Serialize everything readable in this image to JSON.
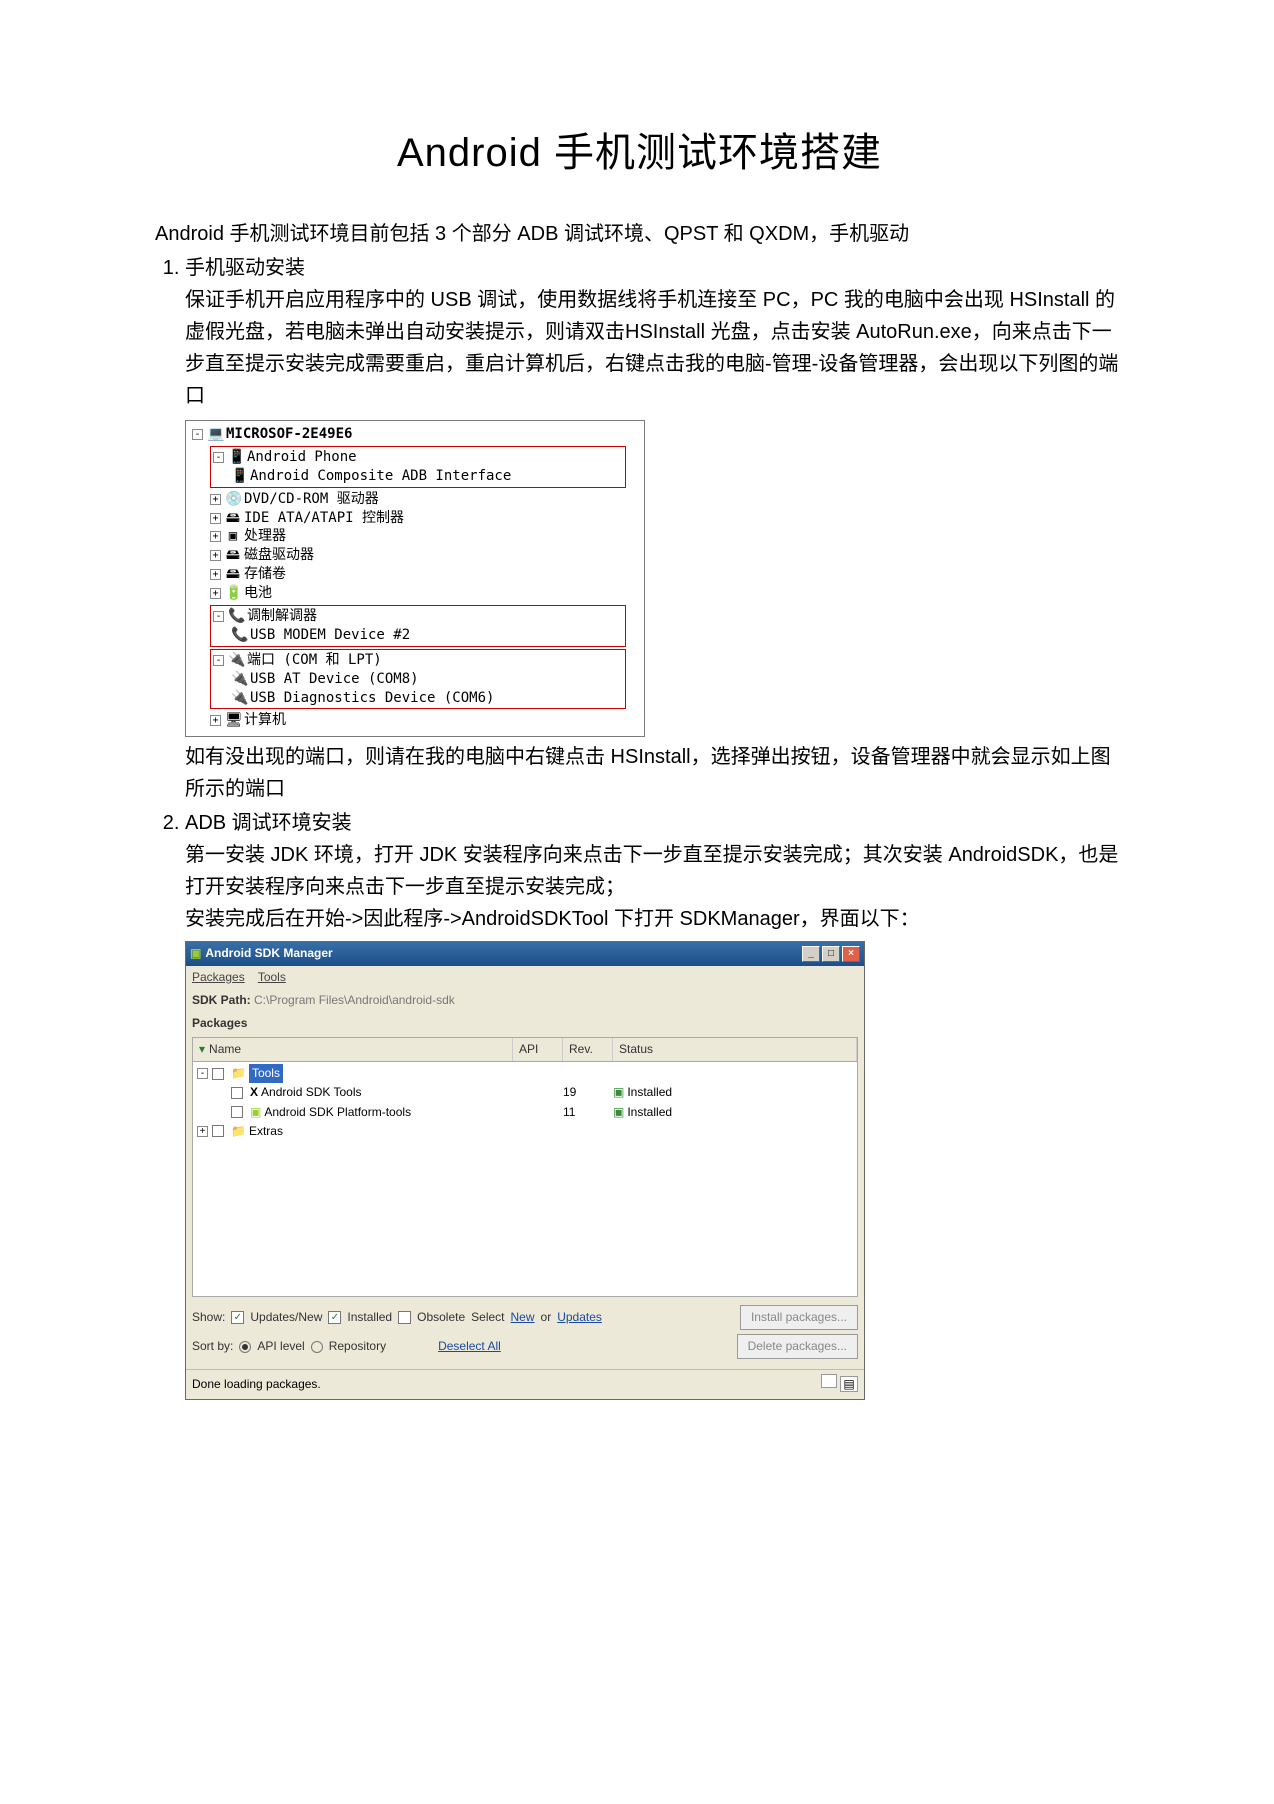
{
  "title": "Android 手机测试环境搭建",
  "intro": "Android 手机测试环境目前包括 3 个部分 ADB 调试环境、QPST 和 QXDM，手机驱动",
  "section1": {
    "heading": "手机驱动安装",
    "para1": "保证手机开启应用程序中的 USB 调试，使用数据线将手机连接至 PC，PC 我的电脑中会出现 HSInstall 的虚假光盘，若电脑未弹出自动安装提示，则请双击HSInstall 光盘，点击安装 AutoRun.exe，向来点击下一步直至提示安装完成需要重启，重启计算机后，右键点击我的电脑-管理-设备管理器，会出现以下列图的端口",
    "para2": "如有没出现的端口，则请在我的电脑中右键点击 HSInstall，选择弹出按钮，设备管理器中就会显示如上图所示的端口"
  },
  "devmgr": {
    "root": "MICROSOF-2E49E6",
    "android_phone": "Android Phone",
    "android_adb": "Android Composite ADB Interface",
    "dvd": "DVD/CD-ROM 驱动器",
    "ide": "IDE ATA/ATAPI 控制器",
    "cpu": "处理器",
    "disk": "磁盘驱动器",
    "vol": "存储卷",
    "battery": "电池",
    "modem": "调制解调器",
    "usb_modem": "USB MODEM Device #2",
    "ports": "端口 (COM 和 LPT)",
    "usb_at": "USB AT Device (COM8)",
    "usb_diag": "USB Diagnostics Device (COM6)",
    "computer": "计算机"
  },
  "section2": {
    "heading": "ADB 调试环境安装",
    "para1": "第一安装 JDK 环境，打开 JDK 安装程序向来点击下一步直至提示安装完成；其次安装 AndroidSDK，也是打开安装程序向来点击下一步直至提示安装完成；",
    "para2": "安装完成后在开始->因此程序->AndroidSDKTool 下打开 SDKManager，界面以下："
  },
  "sdk": {
    "title": "Android SDK Manager",
    "menu_packages": "Packages",
    "menu_tools": "Tools",
    "path_label": "SDK Path:",
    "path_value": "C:\\Program Files\\Android\\android-sdk",
    "section_label": "Packages",
    "columns": {
      "name": "Name",
      "api": "API",
      "rev": "Rev.",
      "status": "Status"
    },
    "rows": {
      "tools_folder": "Tools",
      "sdk_tools": "Android SDK Tools",
      "sdk_tools_rev": "19",
      "sdk_tools_status": "Installed",
      "plat_tools": "Android SDK Platform-tools",
      "plat_tools_rev": "11",
      "plat_tools_status": "Installed",
      "extras": "Extras"
    },
    "footer": {
      "show": "Show:",
      "updates": "Updates/New",
      "installed": "Installed",
      "obsolete": "Obsolete",
      "select": "Select",
      "new": "New",
      "or": "or",
      "updates_link": "Updates",
      "install_btn": "Install packages...",
      "sort": "Sort by:",
      "api_level": "API level",
      "repository": "Repository",
      "deselect": "Deselect All",
      "delete_btn": "Delete packages..."
    },
    "status": "Done loading packages."
  }
}
